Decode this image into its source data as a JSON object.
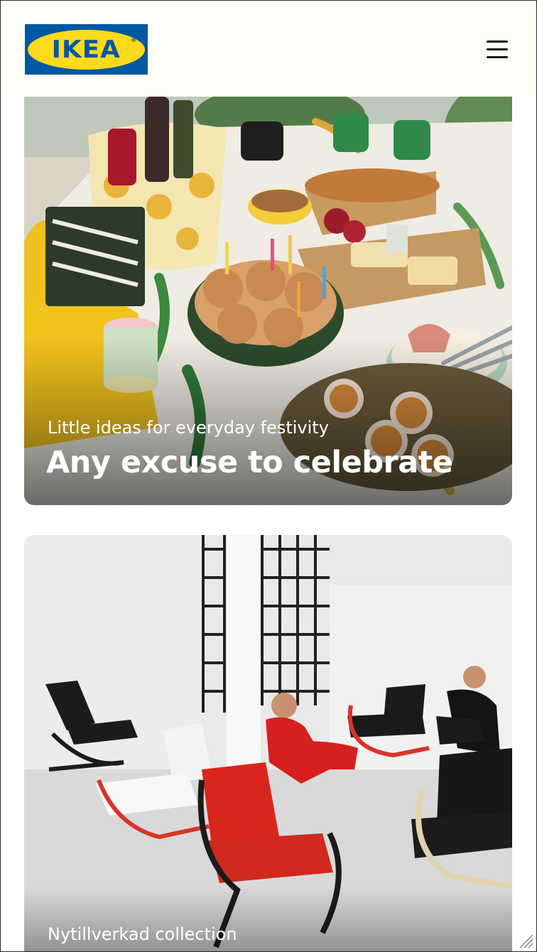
{
  "header": {
    "logo_text": "IKEA",
    "logo_registered": "®",
    "brand_colors": {
      "blue": "#0058a3",
      "yellow": "#ffda1a"
    },
    "menu_icon": "hamburger-menu-icon"
  },
  "cards": [
    {
      "kicker": "Little ideas for everyday festivity",
      "title": "Any excuse to celebrate",
      "image_alt": "Festive table with cinnamon buns with candles, cheese board, bread and drinks"
    },
    {
      "kicker": "Nytillverkad collection",
      "image_alt": "People sitting in armchairs in a bright white room"
    }
  ]
}
